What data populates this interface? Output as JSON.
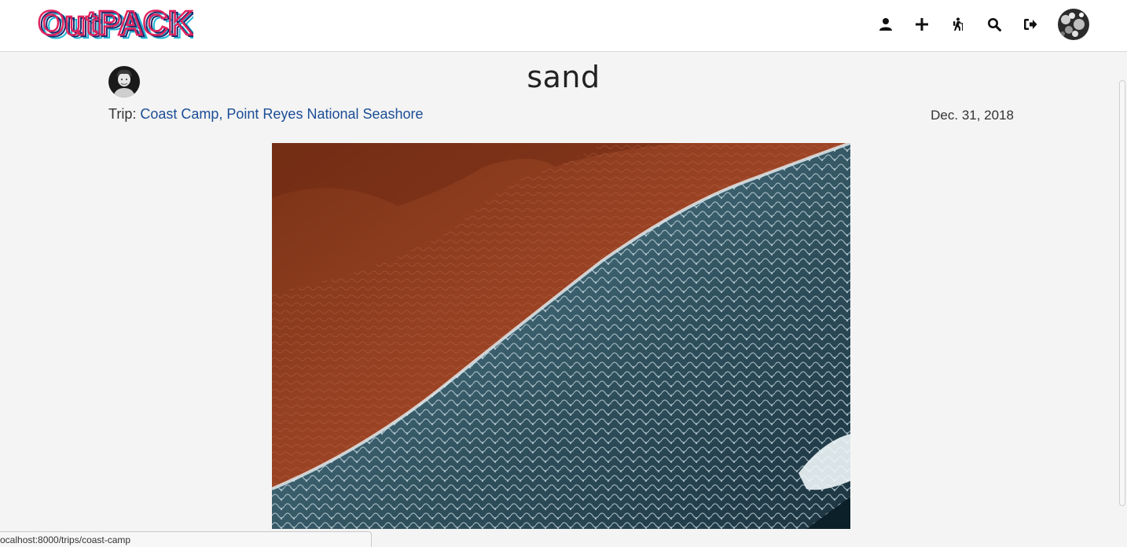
{
  "app": {
    "logo_text": "OutPACK"
  },
  "nav": {
    "icons": [
      "user-icon",
      "plus-icon",
      "hiking-icon",
      "search-icon",
      "sign-out-icon"
    ]
  },
  "post": {
    "title": "sand",
    "trip_prefix": "Trip:",
    "trip_name": "Coast Camp, Point Reyes National Seashore",
    "date": "Dec. 31, 2018"
  },
  "status_bar": {
    "url": "ocalhost:8000/trips/coast-camp"
  },
  "colors": {
    "link": "#1b4d97",
    "logo_red": "#e0245e",
    "logo_cyan": "#1fb5d6",
    "logo_navy": "#1d2a6b"
  }
}
